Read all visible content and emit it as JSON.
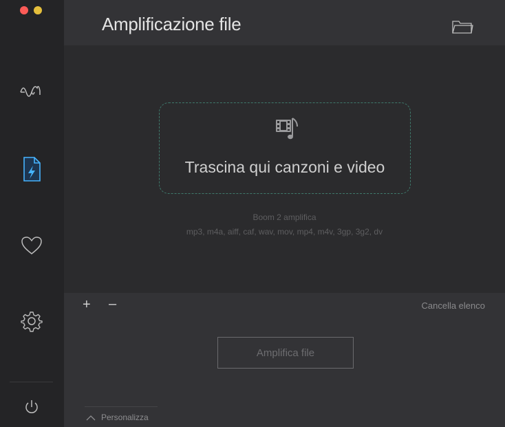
{
  "window": {
    "controls": [
      "close",
      "minimize"
    ]
  },
  "sidebar": {
    "items": [
      {
        "icon": "waveform-icon",
        "active": false
      },
      {
        "icon": "amplify-file-icon",
        "active": true,
        "accent": "#3fa9ff"
      },
      {
        "icon": "heart-icon",
        "active": false
      },
      {
        "icon": "gear-icon",
        "active": false
      }
    ],
    "bottom_icon": "power-icon"
  },
  "header": {
    "title": "Amplificazione file",
    "folder_icon": "folder-icon"
  },
  "dropzone": {
    "icon": "video-music-icon",
    "text": "Trascina qui canzoni e video",
    "border_color": "#3f7a6c"
  },
  "supported": {
    "title": "Boom 2 amplifica",
    "formats": "mp3, m4a, aiff, caf, wav, mov, mp4, m4v, 3gp, 3g2, dv"
  },
  "list_toolbar": {
    "add_label": "+",
    "remove_label": "–",
    "clear_label": "Cancella elenco"
  },
  "actions": {
    "amplify_label": "Amplifica file",
    "customize_label": "Personalizza"
  }
}
